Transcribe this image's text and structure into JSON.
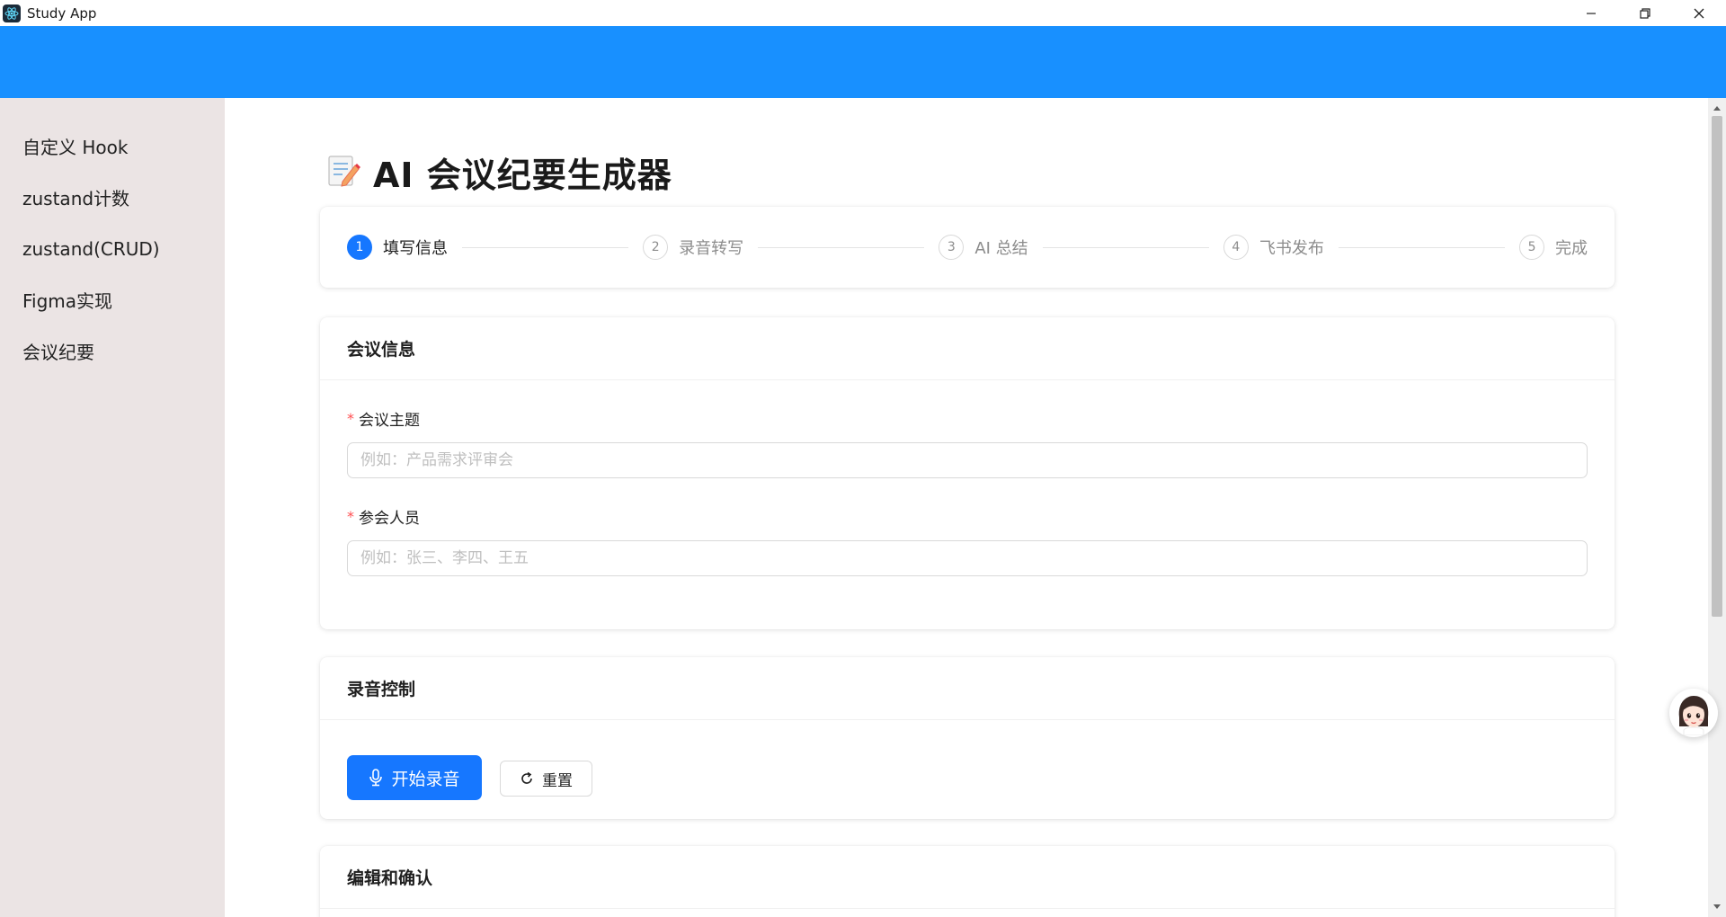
{
  "window": {
    "title": "Study App",
    "icons": [
      "app-icon",
      "minimize-icon",
      "restore-icon",
      "close-icon"
    ]
  },
  "colors": {
    "header": "#1890ff",
    "sidebar": "#ebe4e4",
    "primary": "#1677ff",
    "required": "#ff4d4f"
  },
  "sidebar": {
    "items": [
      {
        "label": "自定义 Hook"
      },
      {
        "label": "zustand计数"
      },
      {
        "label": "zustand(CRUD)"
      },
      {
        "label": "Figma实现"
      },
      {
        "label": "会议纪要"
      }
    ]
  },
  "main": {
    "title": "AI 会议纪要生成器",
    "title_icon": "memo-icon",
    "steps": [
      {
        "number": "1",
        "label": "填写信息",
        "active": true
      },
      {
        "number": "2",
        "label": "录音转写",
        "active": false
      },
      {
        "number": "3",
        "label": "AI 总结",
        "active": false
      },
      {
        "number": "4",
        "label": "飞书发布",
        "active": false
      },
      {
        "number": "5",
        "label": "完成",
        "active": false
      }
    ],
    "meeting_info": {
      "title": "会议信息",
      "required_mark": "*",
      "topic_label": "会议主题",
      "topic_placeholder": "例如：产品需求评审会",
      "topic_value": "",
      "attendees_label": "参会人员",
      "attendees_placeholder": "例如：张三、李四、王五",
      "attendees_value": ""
    },
    "recording": {
      "title": "录音控制",
      "start_label": "开始录音",
      "start_icon": "microphone-icon",
      "reset_label": "重置",
      "reset_icon": "reload-icon"
    },
    "edit": {
      "title": "编辑和确认"
    }
  },
  "assistant": {
    "icon": "assistant-avatar-icon"
  }
}
